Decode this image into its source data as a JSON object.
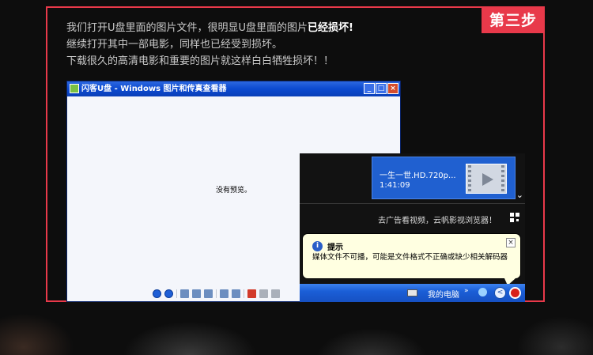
{
  "step_badge": "第三步",
  "description": {
    "line1_pre": "我们打开U盘里面的图片文件，很明显U盘里面的图片",
    "line1_highlight": "已经损坏!",
    "line2": "继续打开其中一部电影，同样也已经受到损坏。",
    "line3": "下载很久的高清电影和重要的图片就这样白白牺牲损坏！！"
  },
  "viewer": {
    "title": "闪客U盘 - Windows 图片和传真查看器",
    "no_preview": "没有预览。",
    "window_buttons": [
      "_",
      "□",
      "×"
    ]
  },
  "player": {
    "now_playing_title": "一生一世.HD.720p...",
    "duration": "1:41:09",
    "ad_text": "去广告看视频，云帆影视浏览器！",
    "chevron": "⌄"
  },
  "balloon": {
    "title": "提示",
    "info_glyph": "i",
    "close_glyph": "×",
    "message": "媒体文件不可播，可能是文件格式不正确或缺少相关解码器"
  },
  "taskbar": {
    "my_computer": "我的电脑",
    "arrows": "»",
    "tray_back_glyph": "<"
  },
  "icons": {
    "viewer_app": "picture-viewer-icon",
    "info": "info-icon",
    "play_thumbnail": "video-thumbnail-icon",
    "keyboard": "keyboard-icon"
  },
  "colors": {
    "accent_red": "#e8394a",
    "xp_blue": "#1b5fd7",
    "balloon_bg": "#ffffe1"
  }
}
